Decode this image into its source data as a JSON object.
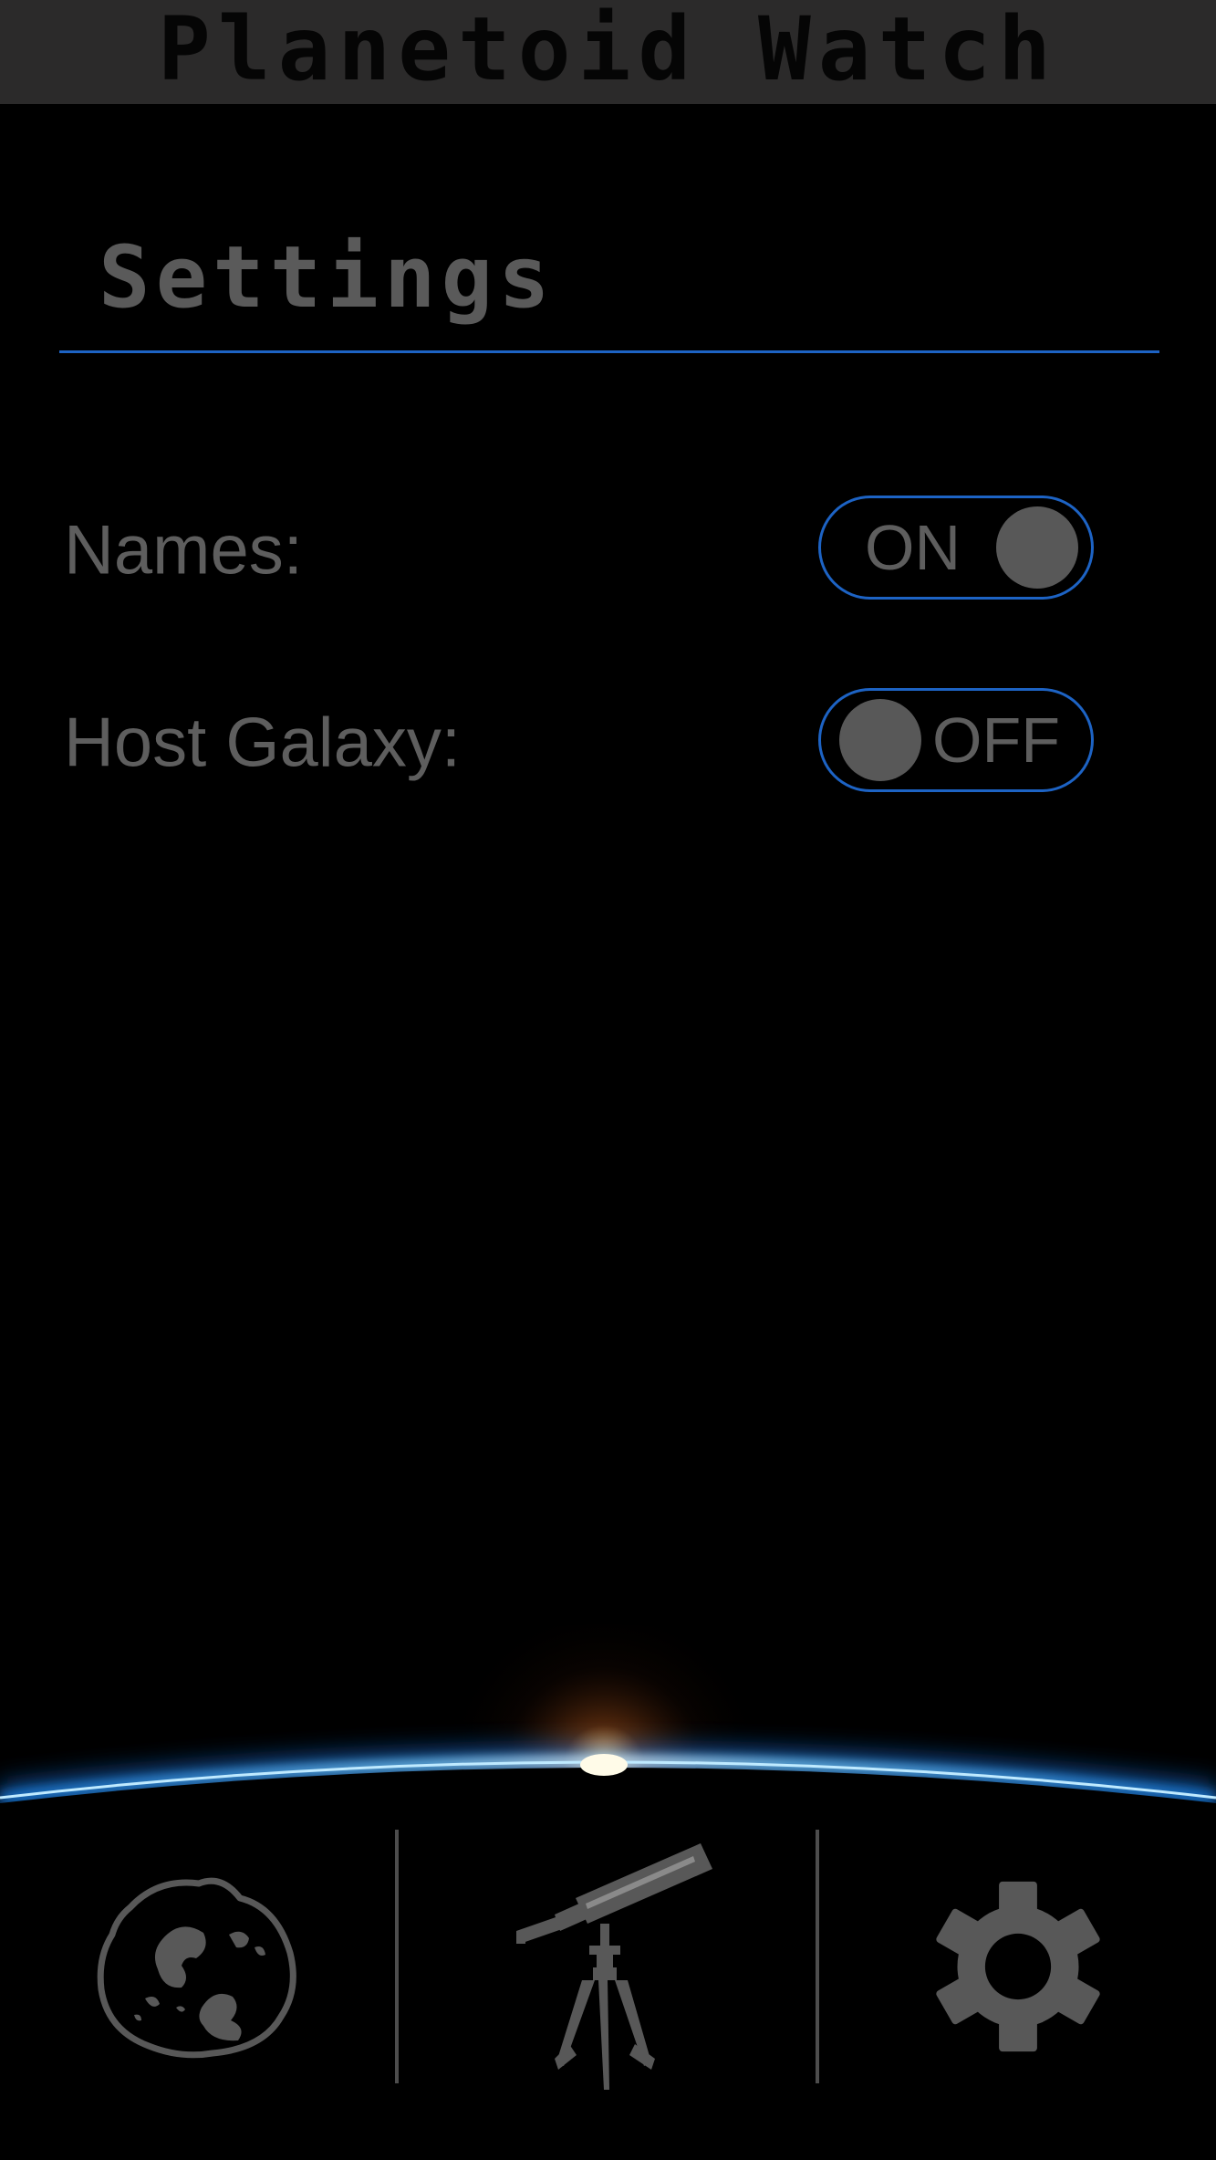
{
  "app": {
    "title": "Planetoid Watch"
  },
  "settings": {
    "heading": "Settings",
    "rows": [
      {
        "label": "Names:",
        "toggle_text": "ON",
        "value": true
      },
      {
        "label": "Host Galaxy:",
        "toggle_text": "OFF",
        "value": false
      }
    ]
  },
  "tab_bar": {
    "tabs": [
      {
        "icon": "asteroid-icon"
      },
      {
        "icon": "telescope-icon"
      },
      {
        "icon": "gear-icon"
      }
    ]
  },
  "colors": {
    "title_bar_bg": "#2b2a2a",
    "accent_blue": "#1d63c4",
    "text_gray": "#5e5e5e",
    "icon_gray": "#585858",
    "background": "#000000"
  }
}
